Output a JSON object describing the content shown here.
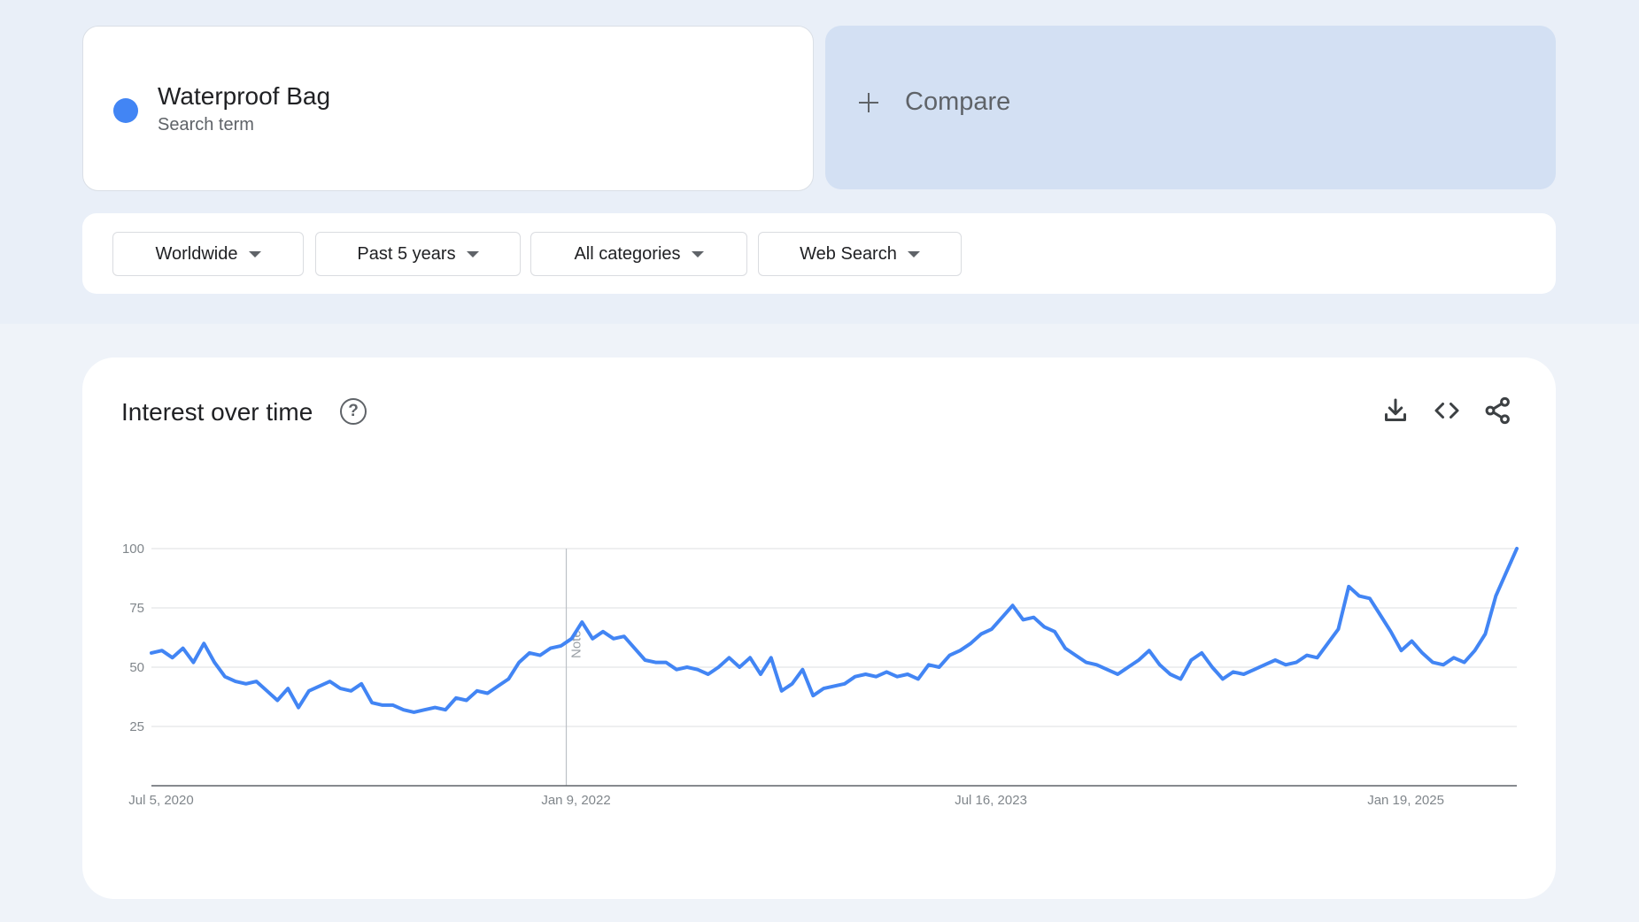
{
  "search_term": {
    "name": "Waterproof Bag",
    "sublabel": "Search term",
    "color": "#4285f4"
  },
  "compare": {
    "label": "Compare",
    "icon": "plus-icon"
  },
  "filters": [
    {
      "label": "Worldwide"
    },
    {
      "label": "Past 5 years"
    },
    {
      "label": "All categories"
    },
    {
      "label": "Web Search"
    }
  ],
  "chart_card": {
    "title": "Interest over time",
    "help_icon": "question-circle-icon",
    "actions": [
      "download-icon",
      "embed-code-icon",
      "share-icon"
    ],
    "note_label": "Note"
  },
  "chart_data": {
    "type": "line",
    "title": "",
    "xlabel": "",
    "ylabel": "",
    "ylim": [
      0,
      100
    ],
    "yticks": [
      25,
      50,
      75,
      100
    ],
    "x_tick_labels": [
      "Jul 5, 2020",
      "Jan 9, 2022",
      "Jul 16, 2023",
      "Jan 19, 2025"
    ],
    "x_start": "2020-07-05",
    "x_end": "2025-06-29",
    "annotation": {
      "date": "2022-01-09",
      "label": "Note"
    },
    "grid": true,
    "series": [
      {
        "color": "#4285f4",
        "points": [
          [
            "2020-07-05",
            56
          ],
          [
            "2020-07-19",
            57
          ],
          [
            "2020-08-02",
            54
          ],
          [
            "2020-08-16",
            58
          ],
          [
            "2020-08-30",
            52
          ],
          [
            "2020-09-13",
            60
          ],
          [
            "2020-09-27",
            52
          ],
          [
            "2020-10-11",
            46
          ],
          [
            "2020-10-25",
            44
          ],
          [
            "2020-11-08",
            43
          ],
          [
            "2020-11-22",
            44
          ],
          [
            "2020-12-06",
            40
          ],
          [
            "2020-12-20",
            36
          ],
          [
            "2021-01-03",
            41
          ],
          [
            "2021-01-17",
            33
          ],
          [
            "2021-01-31",
            40
          ],
          [
            "2021-02-14",
            42
          ],
          [
            "2021-02-28",
            44
          ],
          [
            "2021-03-14",
            41
          ],
          [
            "2021-03-28",
            40
          ],
          [
            "2021-04-11",
            43
          ],
          [
            "2021-04-25",
            35
          ],
          [
            "2021-05-09",
            34
          ],
          [
            "2021-05-23",
            34
          ],
          [
            "2021-06-06",
            32
          ],
          [
            "2021-06-20",
            31
          ],
          [
            "2021-07-04",
            32
          ],
          [
            "2021-07-18",
            33
          ],
          [
            "2021-08-01",
            32
          ],
          [
            "2021-08-15",
            37
          ],
          [
            "2021-08-29",
            36
          ],
          [
            "2021-09-12",
            40
          ],
          [
            "2021-09-26",
            39
          ],
          [
            "2021-10-10",
            42
          ],
          [
            "2021-10-24",
            45
          ],
          [
            "2021-11-07",
            52
          ],
          [
            "2021-11-21",
            56
          ],
          [
            "2021-12-05",
            55
          ],
          [
            "2021-12-19",
            58
          ],
          [
            "2022-01-02",
            59
          ],
          [
            "2022-01-16",
            62
          ],
          [
            "2022-01-30",
            69
          ],
          [
            "2022-02-13",
            62
          ],
          [
            "2022-02-27",
            65
          ],
          [
            "2022-03-13",
            62
          ],
          [
            "2022-03-27",
            63
          ],
          [
            "2022-04-10",
            58
          ],
          [
            "2022-04-24",
            53
          ],
          [
            "2022-05-08",
            52
          ],
          [
            "2022-05-22",
            52
          ],
          [
            "2022-06-05",
            49
          ],
          [
            "2022-06-19",
            50
          ],
          [
            "2022-07-03",
            49
          ],
          [
            "2022-07-17",
            47
          ],
          [
            "2022-07-31",
            50
          ],
          [
            "2022-08-14",
            54
          ],
          [
            "2022-08-28",
            50
          ],
          [
            "2022-09-11",
            54
          ],
          [
            "2022-09-25",
            47
          ],
          [
            "2022-10-09",
            54
          ],
          [
            "2022-10-23",
            40
          ],
          [
            "2022-11-06",
            43
          ],
          [
            "2022-11-20",
            49
          ],
          [
            "2022-12-04",
            38
          ],
          [
            "2022-12-18",
            41
          ],
          [
            "2023-01-01",
            42
          ],
          [
            "2023-01-15",
            43
          ],
          [
            "2023-01-29",
            46
          ],
          [
            "2023-02-12",
            47
          ],
          [
            "2023-02-26",
            46
          ],
          [
            "2023-03-12",
            48
          ],
          [
            "2023-03-26",
            46
          ],
          [
            "2023-04-09",
            47
          ],
          [
            "2023-04-23",
            45
          ],
          [
            "2023-05-07",
            51
          ],
          [
            "2023-05-21",
            50
          ],
          [
            "2023-06-04",
            55
          ],
          [
            "2023-06-18",
            57
          ],
          [
            "2023-07-02",
            60
          ],
          [
            "2023-07-16",
            64
          ],
          [
            "2023-07-30",
            66
          ],
          [
            "2023-08-13",
            71
          ],
          [
            "2023-08-27",
            76
          ],
          [
            "2023-09-10",
            70
          ],
          [
            "2023-09-24",
            71
          ],
          [
            "2023-10-08",
            67
          ],
          [
            "2023-10-22",
            65
          ],
          [
            "2023-11-05",
            58
          ],
          [
            "2023-11-19",
            55
          ],
          [
            "2023-12-03",
            52
          ],
          [
            "2023-12-17",
            51
          ],
          [
            "2023-12-31",
            49
          ],
          [
            "2024-01-14",
            47
          ],
          [
            "2024-01-28",
            50
          ],
          [
            "2024-02-11",
            53
          ],
          [
            "2024-02-25",
            57
          ],
          [
            "2024-03-10",
            51
          ],
          [
            "2024-03-24",
            47
          ],
          [
            "2024-04-07",
            45
          ],
          [
            "2024-04-21",
            53
          ],
          [
            "2024-05-05",
            56
          ],
          [
            "2024-05-19",
            50
          ],
          [
            "2024-06-02",
            45
          ],
          [
            "2024-06-16",
            48
          ],
          [
            "2024-06-30",
            47
          ],
          [
            "2024-07-14",
            49
          ],
          [
            "2024-07-28",
            51
          ],
          [
            "2024-08-11",
            53
          ],
          [
            "2024-08-25",
            51
          ],
          [
            "2024-09-08",
            52
          ],
          [
            "2024-09-22",
            55
          ],
          [
            "2024-10-06",
            54
          ],
          [
            "2024-10-20",
            60
          ],
          [
            "2024-11-03",
            66
          ],
          [
            "2024-11-17",
            84
          ],
          [
            "2024-12-01",
            80
          ],
          [
            "2024-12-15",
            79
          ],
          [
            "2024-12-29",
            72
          ],
          [
            "2025-01-12",
            65
          ],
          [
            "2025-01-26",
            57
          ],
          [
            "2025-02-09",
            61
          ],
          [
            "2025-02-23",
            56
          ],
          [
            "2025-03-09",
            52
          ],
          [
            "2025-03-23",
            51
          ],
          [
            "2025-04-06",
            54
          ],
          [
            "2025-04-20",
            52
          ],
          [
            "2025-05-04",
            57
          ],
          [
            "2025-05-18",
            64
          ],
          [
            "2025-06-01",
            80
          ],
          [
            "2025-06-15",
            90
          ],
          [
            "2025-06-29",
            100
          ]
        ]
      }
    ]
  }
}
